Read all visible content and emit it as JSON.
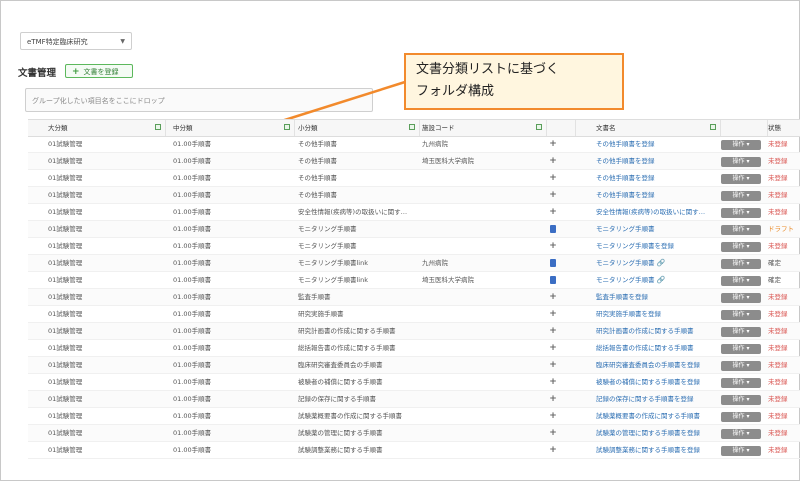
{
  "project_select": {
    "value": "eTMF特定臨床研究"
  },
  "page": {
    "title": "文書管理",
    "register_label": "文書を登録"
  },
  "group_drop": {
    "placeholder": "グループ化したい項目名をここにドロップ"
  },
  "callout": {
    "line1": "文書分類リストに基づく",
    "line2": "フォルダ構成"
  },
  "headers": [
    "大分類",
    "中分類",
    "小分類",
    "施設コード",
    "",
    "文書名",
    "",
    "状態"
  ],
  "op_label": "操作",
  "colors": {
    "accent_orange": "#f28a2c",
    "status_red": "#d9534f",
    "link_blue": "#2d6fb3"
  },
  "rows": [
    {
      "dai": "01試験管理",
      "chu": "01.00手順書",
      "sho": "その他手順書",
      "shi": "九州病院",
      "act": "plus",
      "doc": "その他手順書を登録",
      "st": "未登録",
      "stc": "red"
    },
    {
      "dai": "01試験管理",
      "chu": "01.00手順書",
      "sho": "その他手順書",
      "shi": "埼玉医科大学病院",
      "act": "plus",
      "doc": "その他手順書を登録",
      "st": "未登録",
      "stc": "red"
    },
    {
      "dai": "01試験管理",
      "chu": "01.00手順書",
      "sho": "その他手順書",
      "shi": "",
      "act": "plus",
      "doc": "その他手順書を登録",
      "st": "未登録",
      "stc": "red"
    },
    {
      "dai": "01試験管理",
      "chu": "01.00手順書",
      "sho": "その他手順書",
      "shi": "",
      "act": "plus",
      "doc": "その他手順書を登録",
      "st": "未登録",
      "stc": "red"
    },
    {
      "dai": "01試験管理",
      "chu": "01.00手順書",
      "sho": "安全性情報(疾病等)の取扱いに関す…",
      "shi": "",
      "act": "plus",
      "doc": "安全性情報(疾病等)の取扱いに関す…",
      "st": "未登録",
      "stc": "red"
    },
    {
      "dai": "01試験管理",
      "chu": "01.00手順書",
      "sho": "モニタリング手順書",
      "shi": "",
      "act": "doc",
      "doc": "モニタリング手順書",
      "st": "ドラフト",
      "stc": "orange"
    },
    {
      "dai": "01試験管理",
      "chu": "01.00手順書",
      "sho": "モニタリング手順書",
      "shi": "",
      "act": "plus",
      "doc": "モニタリング手順書を登録",
      "st": "未登録",
      "stc": "red"
    },
    {
      "dai": "01試験管理",
      "chu": "01.00手順書",
      "sho": "モニタリング手順書link",
      "shi": "九州病院",
      "act": "doc",
      "doc": "モニタリング手順書",
      "link": true,
      "st": "確定",
      "stc": "gray"
    },
    {
      "dai": "01試験管理",
      "chu": "01.00手順書",
      "sho": "モニタリング手順書link",
      "shi": "埼玉医科大学病院",
      "act": "doc",
      "doc": "モニタリング手順書",
      "link": true,
      "st": "確定",
      "stc": "gray"
    },
    {
      "dai": "01試験管理",
      "chu": "01.00手順書",
      "sho": "監査手順書",
      "shi": "",
      "act": "plus",
      "doc": "監査手順書を登録",
      "st": "未登録",
      "stc": "red"
    },
    {
      "dai": "01試験管理",
      "chu": "01.00手順書",
      "sho": "研究実施手順書",
      "shi": "",
      "act": "plus",
      "doc": "研究実施手順書を登録",
      "st": "未登録",
      "stc": "red"
    },
    {
      "dai": "01試験管理",
      "chu": "01.00手順書",
      "sho": "研究計画書の作成に関する手順書",
      "shi": "",
      "act": "plus",
      "doc": "研究計画書の作成に関する手順書",
      "st": "未登録",
      "stc": "red"
    },
    {
      "dai": "01試験管理",
      "chu": "01.00手順書",
      "sho": "総括報告書の作成に関する手順書",
      "shi": "",
      "act": "plus",
      "doc": "総括報告書の作成に関する手順書",
      "st": "未登録",
      "stc": "red"
    },
    {
      "dai": "01試験管理",
      "chu": "01.00手順書",
      "sho": "臨床研究審査委員会の手順書",
      "shi": "",
      "act": "plus",
      "doc": "臨床研究審査委員会の手順書を登録",
      "st": "未登録",
      "stc": "red"
    },
    {
      "dai": "01試験管理",
      "chu": "01.00手順書",
      "sho": "被験者の補償に関する手順書",
      "shi": "",
      "act": "plus",
      "doc": "被験者の補償に関する手順書を登録",
      "st": "未登録",
      "stc": "red"
    },
    {
      "dai": "01試験管理",
      "chu": "01.00手順書",
      "sho": "記録の保存に関する手順書",
      "shi": "",
      "act": "plus",
      "doc": "記録の保存に関する手順書を登録",
      "st": "未登録",
      "stc": "red"
    },
    {
      "dai": "01試験管理",
      "chu": "01.00手順書",
      "sho": "試験薬概要書の作成に関する手順書",
      "shi": "",
      "act": "plus",
      "doc": "試験薬概要書の作成に関する手順書",
      "st": "未登録",
      "stc": "red"
    },
    {
      "dai": "01試験管理",
      "chu": "01.00手順書",
      "sho": "試験薬の管理に関する手順書",
      "shi": "",
      "act": "plus",
      "doc": "試験薬の管理に関する手順書を登録",
      "st": "未登録",
      "stc": "red"
    },
    {
      "dai": "01試験管理",
      "chu": "01.00手順書",
      "sho": "試験調整業務に関する手順書",
      "shi": "",
      "act": "plus",
      "doc": "試験調整業務に関する手順書を登録",
      "st": "未登録",
      "stc": "red"
    }
  ]
}
